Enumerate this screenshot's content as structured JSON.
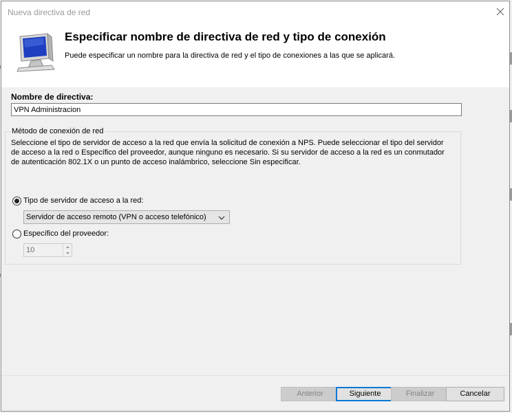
{
  "window": {
    "title": "Nueva directiva de red",
    "close_icon": "close-icon"
  },
  "header": {
    "icon": "monitor-icon",
    "title": "Especificar nombre de directiva de red y tipo de conexión",
    "description": "Puede especificar un nombre para la directiva de red y el tipo de conexiones a las que se aplicará."
  },
  "policy_name": {
    "label": "Nombre de directiva:",
    "value": "VPN Administracion"
  },
  "connection_method": {
    "legend": "Método de conexión de red",
    "description": "Seleccione el tipo de servidor de acceso a la red que envía la solicitud de conexión a NPS. Puede seleccionar el tipo del servidor de acceso a la red o Específico del proveedor, aunque ninguno es necesario. Si su servidor de acceso a la red es un conmutador de autenticación 802.1X o un punto de acceso inalámbrico, seleccione Sin especificar.",
    "option_server_type": {
      "label": "Tipo de servidor de acceso a la red:",
      "selected": true,
      "dropdown_value": "Servidor de acceso remoto (VPN o acceso telefónico)"
    },
    "option_vendor": {
      "label": "Específico del proveedor:",
      "selected": false,
      "spin_value": "10"
    }
  },
  "buttons": {
    "back": "Anterior",
    "next": "Siguiente",
    "finish": "Finalizar",
    "cancel": "Cancelar"
  },
  "colors": {
    "accent": "#0078d7",
    "dialog_bg": "#f0f0f0",
    "header_bg": "#ffffff",
    "monitor_screen": "#1e3fbf"
  }
}
